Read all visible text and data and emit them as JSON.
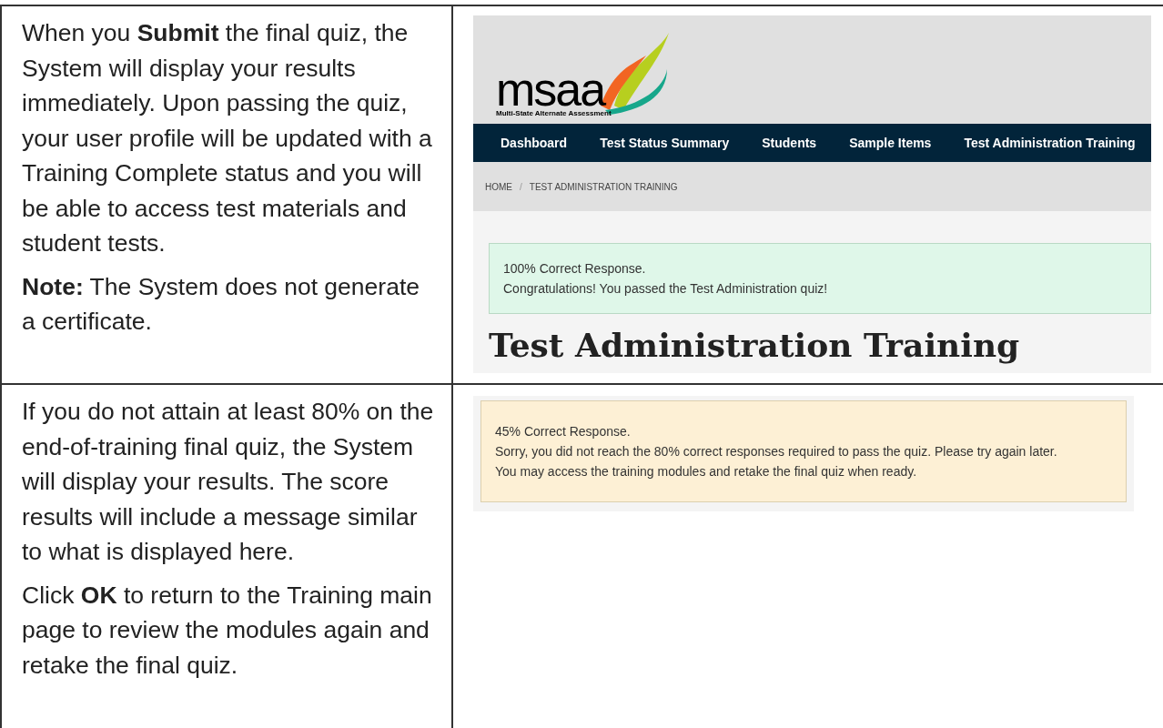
{
  "rows": [
    {
      "paragraphs": [
        "When you **Submit** the final quiz, the System will display your results immediately. Upon passing the quiz, your user profile will be updated with a Training Complete status and you will be able to access test materials and student tests.",
        "**Note:** The System does not generate a certificate."
      ],
      "screenshot": {
        "kind": "site",
        "logo": {
          "text": "msaa",
          "tagline": "Multi-State Alternate Assessment"
        },
        "nav": [
          "Dashboard",
          "Test Status Summary",
          "Students",
          "Sample Items",
          "Test Administration Training"
        ],
        "breadcrumb": {
          "items": [
            "HOME",
            "TEST ADMINISTRATION TRAINING"
          ],
          "separator": "/"
        },
        "alert": {
          "kind": "success",
          "lines": [
            "100% Correct Response.",
            "Congratulations! You passed the Test Administration quiz!"
          ]
        },
        "heading": "Test Administration Training"
      }
    },
    {
      "paragraphs": [
        "If you do not attain at least 80% on the end-of-training final quiz, the System will display your results. The score results will include a message similar to what is displayed here.",
        "Click **OK** to return to the Training main page to review the modules again and retake the final quiz."
      ],
      "screenshot": {
        "kind": "alert-only",
        "alert": {
          "kind": "warning",
          "lines": [
            "45% Correct Response.",
            "Sorry, you did not reach the 80% correct responses required to pass the quiz. Please try again later.",
            "You may access the training modules and retake the final quiz when ready."
          ]
        }
      }
    }
  ]
}
